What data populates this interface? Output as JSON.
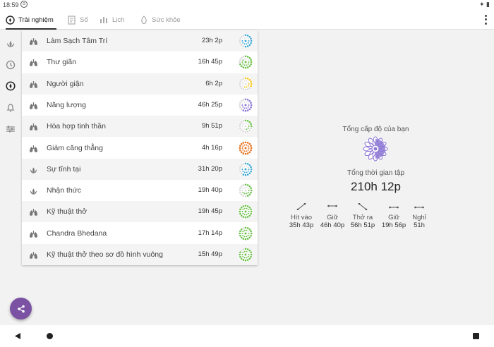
{
  "status_bar": {
    "time": "18:59",
    "app_icon": "notification-icon",
    "right_icon": "signal-icon"
  },
  "tabs": [
    {
      "label": "Trải nghiệm",
      "icon": "compass-icon",
      "active": true
    },
    {
      "label": "Số",
      "icon": "document-icon",
      "active": false
    },
    {
      "label": "Lịch",
      "icon": "bar-chart-icon",
      "active": false
    },
    {
      "label": "Sức khỏe",
      "icon": "health-icon",
      "active": false
    }
  ],
  "rail": [
    {
      "icon": "lotus-icon"
    },
    {
      "icon": "history-icon"
    },
    {
      "icon": "compass-icon"
    },
    {
      "icon": "bell-icon"
    },
    {
      "icon": "sliders-icon"
    }
  ],
  "items": [
    {
      "name": "Làm Sạch Tâm Trí",
      "duration": "23h 2p",
      "icon": "lungs-icon",
      "progress_color": "#3fa7d6",
      "progress": 0.55
    },
    {
      "name": "Thư giãn",
      "duration": "16h 45p",
      "icon": "lungs-icon",
      "progress_color": "#6cc04a",
      "progress": 0.7
    },
    {
      "name": "Người giận",
      "duration": "6h 2p",
      "icon": "lungs-icon",
      "progress_color": "#f5c518",
      "progress": 0.35
    },
    {
      "name": "Năng lượng",
      "duration": "46h 25p",
      "icon": "lungs-icon",
      "progress_color": "#8e79d6",
      "progress": 0.6
    },
    {
      "name": "Hòa hợp tinh thần",
      "duration": "9h 51p",
      "icon": "lungs-icon",
      "progress_color": "#6cc04a",
      "progress": 0.3
    },
    {
      "name": "Giảm căng thẳng",
      "duration": "4h 16p",
      "icon": "lungs-icon",
      "progress_color": "#e8711a",
      "progress": 1
    },
    {
      "name": "Sự tĩnh tại",
      "duration": "31h 20p",
      "icon": "lotus-icon",
      "progress_color": "#3fa7d6",
      "progress": 0.6
    },
    {
      "name": "Nhận thức",
      "duration": "19h 40p",
      "icon": "lotus-icon",
      "progress_color": "#6cc04a",
      "progress": 0.5
    },
    {
      "name": "Kỹ thuật thở",
      "duration": "19h 45p",
      "icon": "lungs-icon",
      "progress_color": "#6cc04a",
      "progress": 1
    },
    {
      "name": "Chandra Bhedana",
      "duration": "17h 14p",
      "icon": "lungs-icon",
      "progress_color": "#6cc04a",
      "progress": 0.9
    },
    {
      "name": "Kỹ thuật thở theo sơ đồ hình vuông",
      "duration": "15h 49p",
      "icon": "lungs-icon",
      "progress_color": "#6cc04a",
      "progress": 0.85
    }
  ],
  "summary": {
    "level_label": "Tổng cấp độ của bạn",
    "total_label": "Tổng thời gian tập",
    "total_value": "210h 12p",
    "accent_color": "#8e79d6",
    "stats": [
      {
        "label": "Hít vào",
        "value": "35h 43p",
        "icon": "inhale-arrow-icon"
      },
      {
        "label": "Giữ",
        "value": "46h 40p",
        "icon": "hold-arrow-icon"
      },
      {
        "label": "Thở ra",
        "value": "56h 51p",
        "icon": "exhale-arrow-icon"
      },
      {
        "label": "Giữ",
        "value": "19h 56p",
        "icon": "hold-arrow-icon"
      },
      {
        "label": "Nghỉ",
        "value": "51h",
        "icon": "rest-arrow-icon"
      }
    ]
  },
  "fab": {
    "icon": "share-icon",
    "color": "#7b52a3"
  }
}
